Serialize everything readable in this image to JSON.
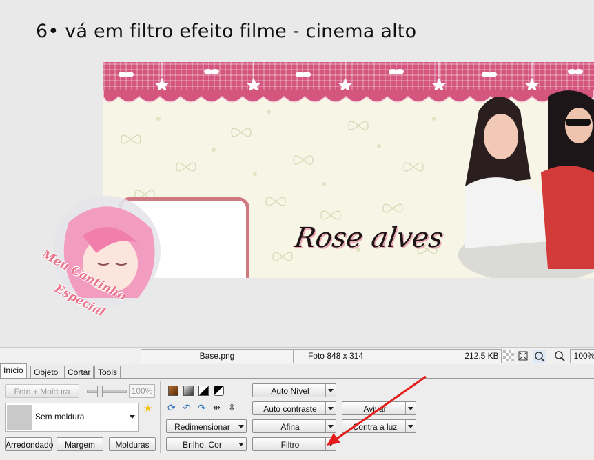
{
  "step": {
    "title": "6• vá em filtro efeito filme - cinema alto"
  },
  "banner": {
    "name_text": "Rose alves",
    "watermark_lines": [
      "Meu Cantinho",
      "Especial"
    ]
  },
  "statusbar": {
    "filename": "Base.png",
    "dimensions": "Foto 848 x 314",
    "filesize": "212.5 KB",
    "zoom": "100%"
  },
  "tabs": [
    {
      "label": "Início",
      "active": true
    },
    {
      "label": "Objeto",
      "active": false
    },
    {
      "label": "Cortar",
      "active": false
    },
    {
      "label": "Tools",
      "active": false
    }
  ],
  "panel": {
    "photo_frame_button": "Foto + Moldura",
    "opacity_value": "100%",
    "frame_select_value": "Sem moldura",
    "rounded_button": "Arredondado",
    "margin_button": "Margem",
    "frames_button": "Molduras",
    "resize_button": "Redimensionar",
    "brightness_button": "Brilho, Cor",
    "auto_level_button": "Auto Nível",
    "auto_contrast_button": "Auto contraste",
    "sharpen_button": "Afina",
    "filter_button": "Filtro",
    "revive_button": "Avivar",
    "backlight_button": "Contra a luz"
  },
  "colors": {
    "banner_pink": "#d4567f",
    "frame_pink": "#cf7a80",
    "annotation_arrow": "#e51c1c"
  }
}
